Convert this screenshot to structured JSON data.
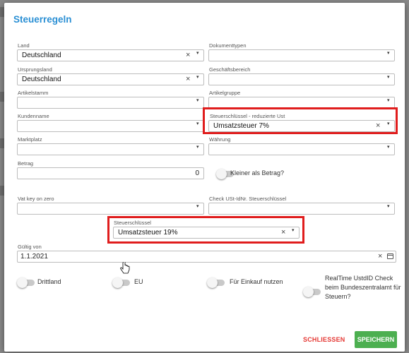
{
  "dialog": {
    "title": "Steuerregeln",
    "fields": {
      "land": {
        "label": "Land",
        "value": "Deutschland"
      },
      "dokumenttypen": {
        "label": "Dokumenttypen",
        "value": ""
      },
      "ursprungsland": {
        "label": "Ursprungsland",
        "value": "Deutschland"
      },
      "geschaeftsbereich": {
        "label": "Geschäftsbereich",
        "value": ""
      },
      "artikelstamm": {
        "label": "Artikelstamm",
        "value": ""
      },
      "artikelgruppe": {
        "label": "Artikelgruppe",
        "value": ""
      },
      "kundenname": {
        "label": "Kundenname",
        "value": ""
      },
      "steuer_reduziert": {
        "label": "Steuerschlüssel - reduzierte Ust",
        "value": "Umsatzsteuer 7%"
      },
      "marktplatz": {
        "label": "Marktplatz",
        "value": ""
      },
      "waehrung": {
        "label": "Währung",
        "value": ""
      },
      "betrag": {
        "label": "Betrag",
        "value": "0"
      },
      "kleiner_als_betrag": {
        "label": "Kleiner als Betrag?"
      },
      "vat_key_zero": {
        "label": "Vat key on zero",
        "value": ""
      },
      "check_ust": {
        "label": "Check USt-IdNr. Steuerschlüssel",
        "value": ""
      },
      "steuerschluessel": {
        "label": "Steuerschlüssel",
        "value": "Umsatzsteuer 19%"
      },
      "gueltig_von": {
        "label": "Gültig von",
        "value": "1.1.2021"
      }
    },
    "toggles": {
      "drittland": "Drittland",
      "eu": "EU",
      "einkauf": "Für Einkauf nutzen",
      "realtime": "RealTime UstdID Check beim Bundeszentralamt für Steuern?"
    },
    "buttons": {
      "close": "SCHLIESSEN",
      "save": "SPEICHERN"
    }
  },
  "colors": {
    "accent": "#2a8fd4",
    "highlight": "#e01d1d",
    "save": "#4caf50",
    "close": "#e53935"
  }
}
